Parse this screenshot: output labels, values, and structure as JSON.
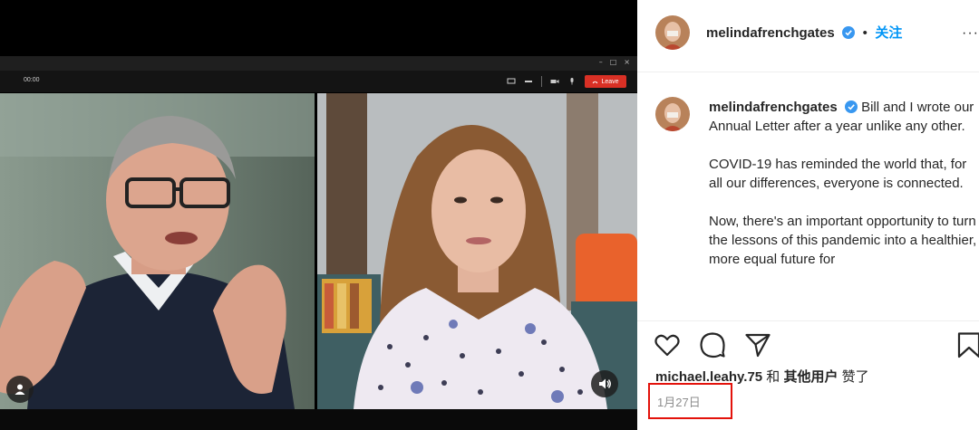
{
  "call": {
    "timer": "00:00",
    "leave_label": "Leave",
    "window_controls": [
      "–",
      "□",
      "×"
    ]
  },
  "post": {
    "username": "melindafrenchgates",
    "follow_label": "关注",
    "separator": "•",
    "more_icon": "···",
    "caption": {
      "username": "melindafrenchgates",
      "paragraph1": "Bill and I wrote our Annual Letter after a year unlike any other.",
      "paragraph2": "COVID-19 has reminded the world that, for all our differences, everyone is connected.",
      "paragraph3": "Now, there's an important opportunity to turn the lessons of this pandemic into a healthier, more equal future for"
    },
    "likes": {
      "user": "michael.leahy.75",
      "connector": "和",
      "others": "其他用户",
      "liked": "赞了"
    },
    "date": "1月27日",
    "icons": [
      "heart-icon",
      "comment-icon",
      "share-icon",
      "bookmark-icon"
    ]
  },
  "colors": {
    "follow": "#0095f6",
    "highlight_box": "#e3120b",
    "leave_button": "#d93025"
  }
}
